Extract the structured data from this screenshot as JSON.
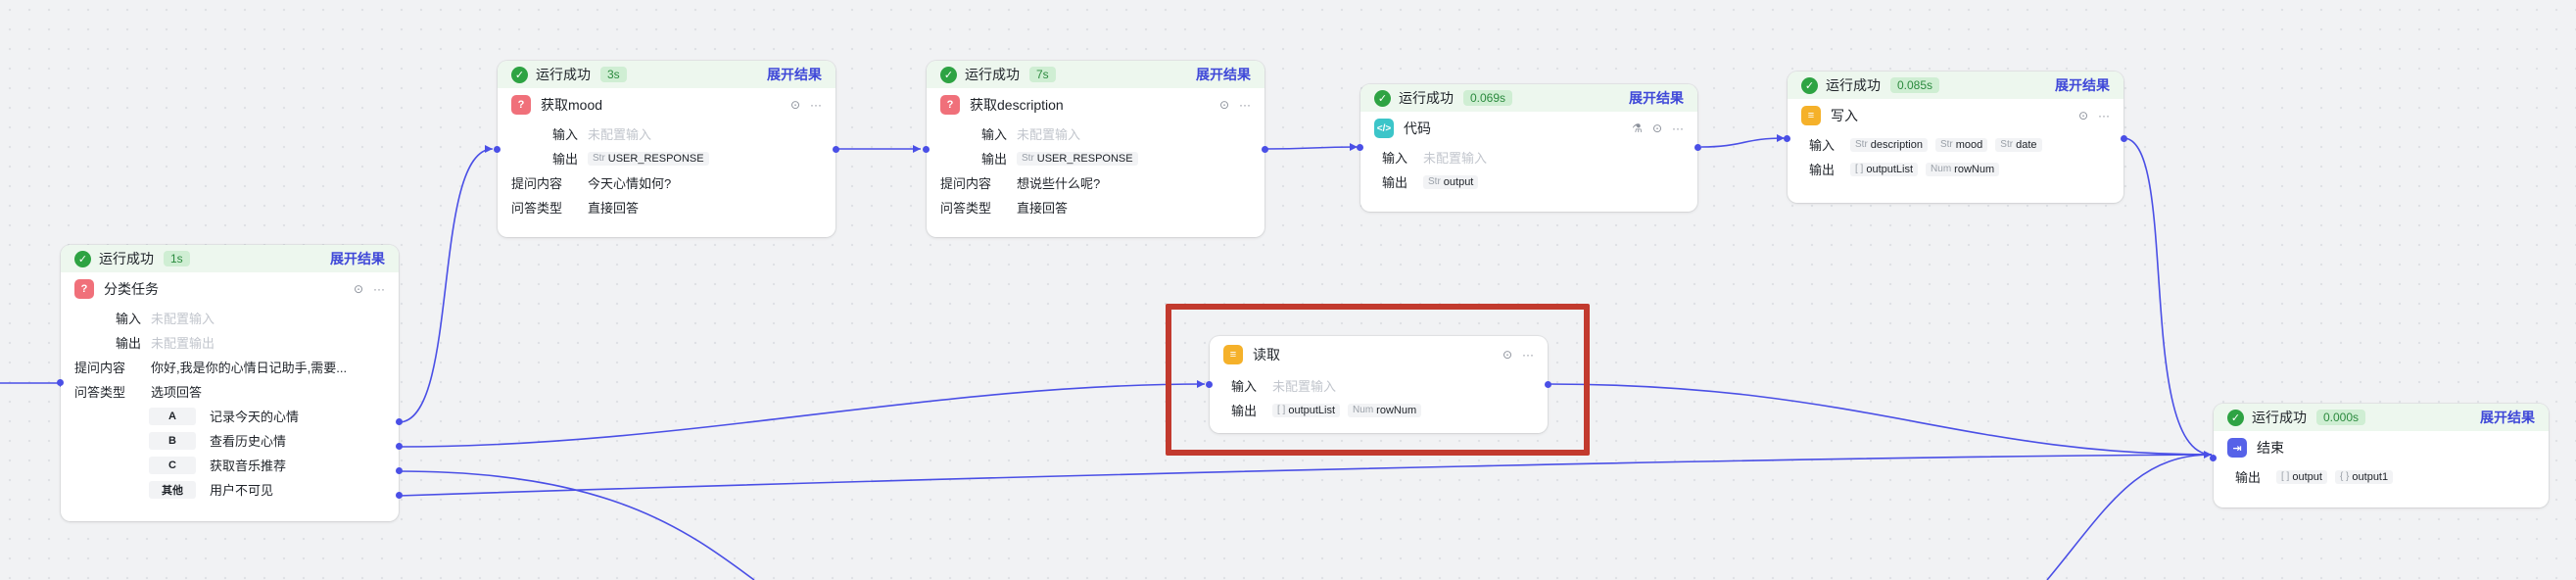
{
  "nodes": {
    "classify": {
      "status": "运行成功",
      "duration": "1s",
      "expand": "展开结果",
      "title": "分类任务",
      "input_label": "输入",
      "input_value": "未配置输入",
      "output_label": "输出",
      "output_value": "未配置输出",
      "prompt_label": "提问内容",
      "prompt_value": "你好,我是你的心情日记助手,需要...",
      "type_label": "问答类型",
      "type_value": "选项回答",
      "options": [
        {
          "key": "A",
          "text": "记录今天的心情"
        },
        {
          "key": "B",
          "text": "查看历史心情"
        },
        {
          "key": "C",
          "text": "获取音乐推荐"
        },
        {
          "key": "其他",
          "text": "用户不可见"
        }
      ]
    },
    "mood": {
      "status": "运行成功",
      "duration": "3s",
      "expand": "展开结果",
      "title": "获取mood",
      "input_label": "输入",
      "input_value": "未配置输入",
      "output_label": "输出",
      "output_type": "Str",
      "output_value": "USER_RESPONSE",
      "prompt_label": "提问内容",
      "prompt_value": "今天心情如何?",
      "type_label": "问答类型",
      "type_value": "直接回答"
    },
    "description": {
      "status": "运行成功",
      "duration": "7s",
      "expand": "展开结果",
      "title": "获取description",
      "input_label": "输入",
      "input_value": "未配置输入",
      "output_label": "输出",
      "output_type": "Str",
      "output_value": "USER_RESPONSE",
      "prompt_label": "提问内容",
      "prompt_value": "想说些什么呢?",
      "type_label": "问答类型",
      "type_value": "直接回答"
    },
    "code": {
      "status": "运行成功",
      "duration": "0.069s",
      "expand": "展开结果",
      "title": "代码",
      "input_label": "输入",
      "input_value": "未配置输入",
      "output_label": "输出",
      "output_type": "Str",
      "output_value": "output"
    },
    "write": {
      "status": "运行成功",
      "duration": "0.085s",
      "expand": "展开结果",
      "title": "写入",
      "input_label": "输入",
      "inputs": [
        {
          "type": "Str",
          "name": "description"
        },
        {
          "type": "Str",
          "name": "mood"
        },
        {
          "type": "Str",
          "name": "date"
        }
      ],
      "output_label": "输出",
      "outputs": [
        {
          "type": "[ ]",
          "name": "outputList"
        },
        {
          "type": "Num",
          "name": "rowNum"
        }
      ]
    },
    "read": {
      "title": "读取",
      "input_label": "输入",
      "input_value": "未配置输入",
      "output_label": "输出",
      "outputs": [
        {
          "type": "[ ]",
          "name": "outputList"
        },
        {
          "type": "Num",
          "name": "rowNum"
        }
      ]
    },
    "end": {
      "status": "运行成功",
      "duration": "0.000s",
      "expand": "展开结果",
      "title": "结束",
      "output_label": "输出",
      "outputs": [
        {
          "type": "[ ]",
          "name": "output"
        },
        {
          "type": "{ }",
          "name": "output1"
        }
      ]
    }
  },
  "icons": {
    "check": "check-circle-icon",
    "question": "question-node-icon",
    "code": "code-node-icon",
    "database": "database-node-icon",
    "end": "end-node-icon",
    "debug": "debug-target-icon",
    "more": "more-icon",
    "test": "test-run-icon"
  },
  "colors": {
    "accent": "#3f48d8",
    "success": "#2ea343",
    "highlight": "#c23a2e",
    "edge": "#4a4fe6"
  }
}
